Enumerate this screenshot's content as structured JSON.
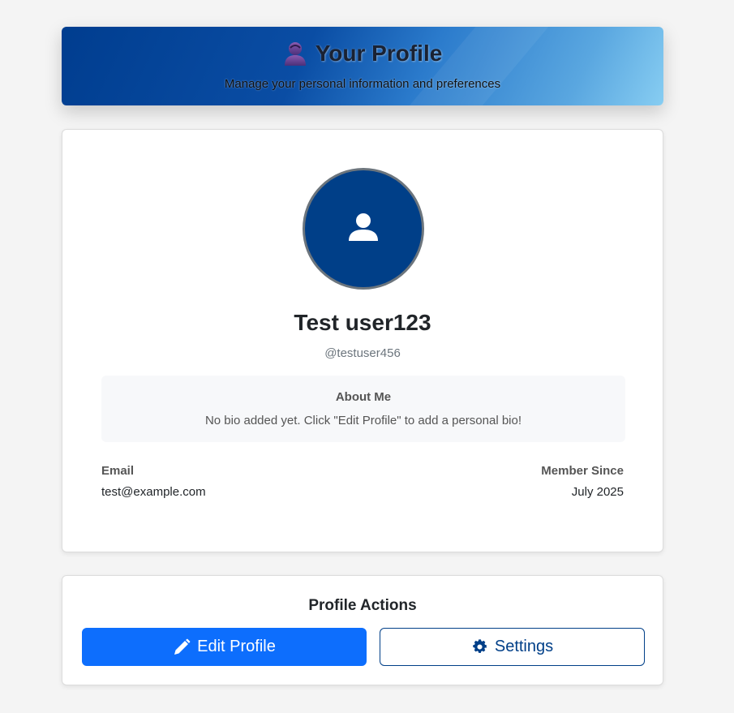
{
  "header": {
    "title": "Your Profile",
    "subtitle": "Manage your personal information and preferences",
    "icon": "user-silhouette-icon"
  },
  "profile": {
    "display_name": "Test user123",
    "username": "@testuser456",
    "avatar_icon": "user-icon",
    "about": {
      "title": "About Me",
      "text": "No bio added yet. Click \"Edit Profile\" to add a personal bio!"
    },
    "email_label": "Email",
    "email_value": "test@example.com",
    "member_since_label": "Member Since",
    "member_since_value": "July 2025"
  },
  "actions": {
    "title": "Profile Actions",
    "edit_label": "Edit Profile",
    "edit_icon": "pencil-icon",
    "settings_label": "Settings",
    "settings_icon": "gear-icon"
  },
  "colors": {
    "primary": "#0d6efd",
    "brand_dark": "#003f88",
    "muted": "#6c757d"
  }
}
